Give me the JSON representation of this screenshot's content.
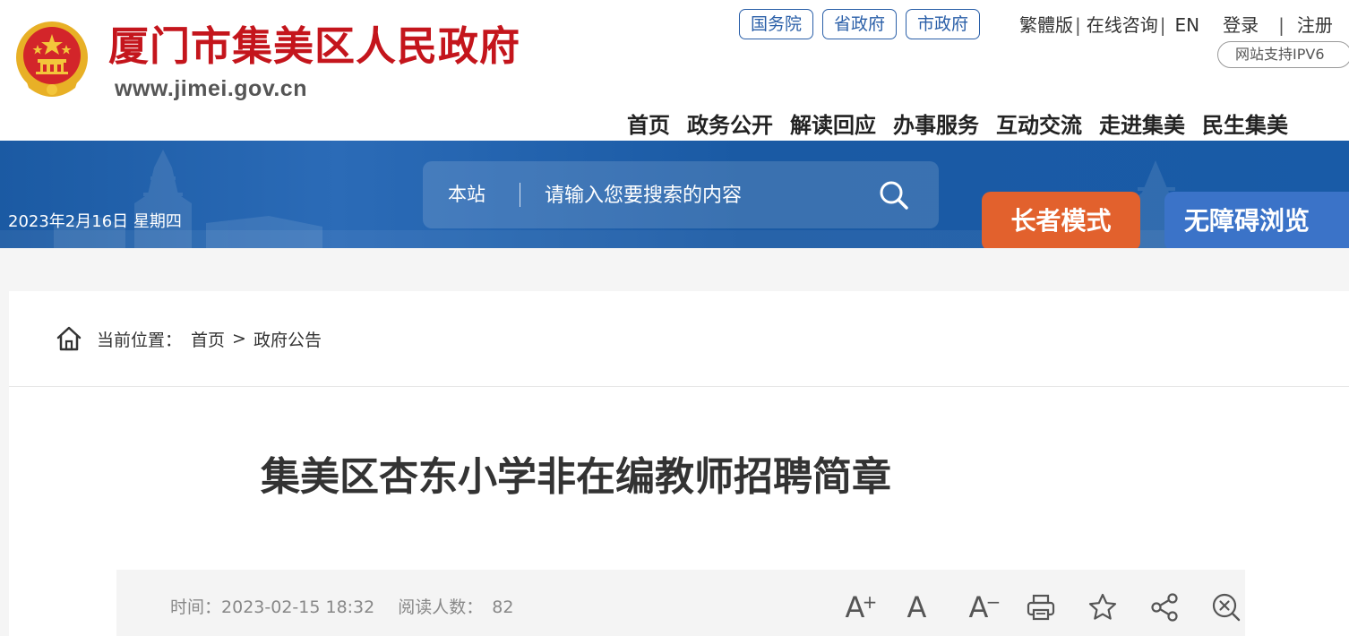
{
  "header": {
    "site_title": "厦门市集美区人民政府",
    "site_url": "www.jimei.gov.cn",
    "gov_links": [
      "国务院",
      "省政府",
      "市政府"
    ],
    "top_links": {
      "traditional": "繁體版",
      "consult": "在线咨询",
      "english": "EN",
      "login": "登录",
      "register": "注册"
    },
    "ipv6_badge": "网站支持IPV6",
    "nav": [
      "首页",
      "政务公开",
      "解读回应",
      "办事服务",
      "互动交流",
      "走进集美",
      "民生集美"
    ]
  },
  "banner": {
    "date": "2023年2月16日 星期四",
    "search": {
      "scope": "本站",
      "placeholder": "请输入您要搜索的内容"
    },
    "elder_mode": "长者模式",
    "accessible": "无障碍浏览"
  },
  "breadcrumb": {
    "label": "当前位置：",
    "items": [
      "首页",
      "政府公告"
    ],
    "separator": ">"
  },
  "article": {
    "title": "集美区杏东小学非在编教师招聘简章",
    "time_label": "时间：",
    "time": "2023-02-15 18:32",
    "views_label": "阅读人数：",
    "views": "82",
    "tools": {
      "font_large": "A",
      "font_large_sup": "+",
      "font_normal": "A",
      "font_small": "A",
      "font_small_sup": "−"
    }
  },
  "colors": {
    "title_red": "#c4151c",
    "banner_blue": "#1b5aa3",
    "elder_orange": "#e2612d",
    "accessible_blue": "#3b73c8",
    "link_blue": "#2a5fa8"
  },
  "icons": [
    "national-emblem-icon",
    "search-icon",
    "home-icon",
    "print-icon",
    "star-icon",
    "share-icon",
    "close-icon"
  ]
}
